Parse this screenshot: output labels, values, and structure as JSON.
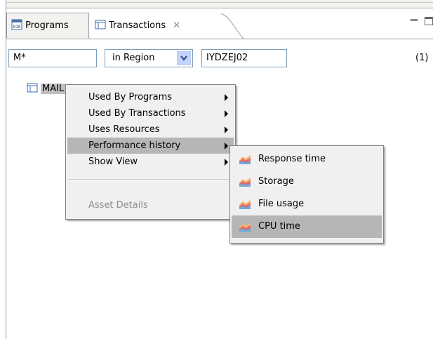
{
  "tabs": [
    {
      "label": "Programs",
      "icon": "program-icon",
      "active": false
    },
    {
      "label": "Transactions",
      "icon": "transaction-table-icon",
      "active": true
    }
  ],
  "filter": {
    "name_value": "M*",
    "scope_value": "in Region",
    "region_value": "IYDZEJ02",
    "count_text": "(1)"
  },
  "tree": {
    "item_label": "MAIL"
  },
  "context_menu": {
    "items": [
      {
        "label": "Used By Programs",
        "submenu": true,
        "enabled": true
      },
      {
        "label": "Used By Transactions",
        "submenu": true,
        "enabled": true
      },
      {
        "label": "Uses Resources",
        "submenu": true,
        "enabled": true
      },
      {
        "label": "Performance history",
        "submenu": true,
        "enabled": true,
        "highlighted": true
      },
      {
        "label": "Show View",
        "submenu": true,
        "enabled": true
      },
      {
        "label": "Asset Details",
        "submenu": false,
        "enabled": false
      }
    ]
  },
  "submenu": {
    "items": [
      {
        "label": "Response time",
        "icon": "area-chart-icon"
      },
      {
        "label": "Storage",
        "icon": "area-chart-icon"
      },
      {
        "label": "File usage",
        "icon": "area-chart-icon"
      },
      {
        "label": "CPU time",
        "icon": "area-chart-icon",
        "highlighted": true
      }
    ]
  },
  "colors": {
    "menu_bg": "#f0f0f0",
    "highlight": "#b6b6b6",
    "field_border": "#7f9db9",
    "dropdown_button": "#c3d3fd"
  }
}
